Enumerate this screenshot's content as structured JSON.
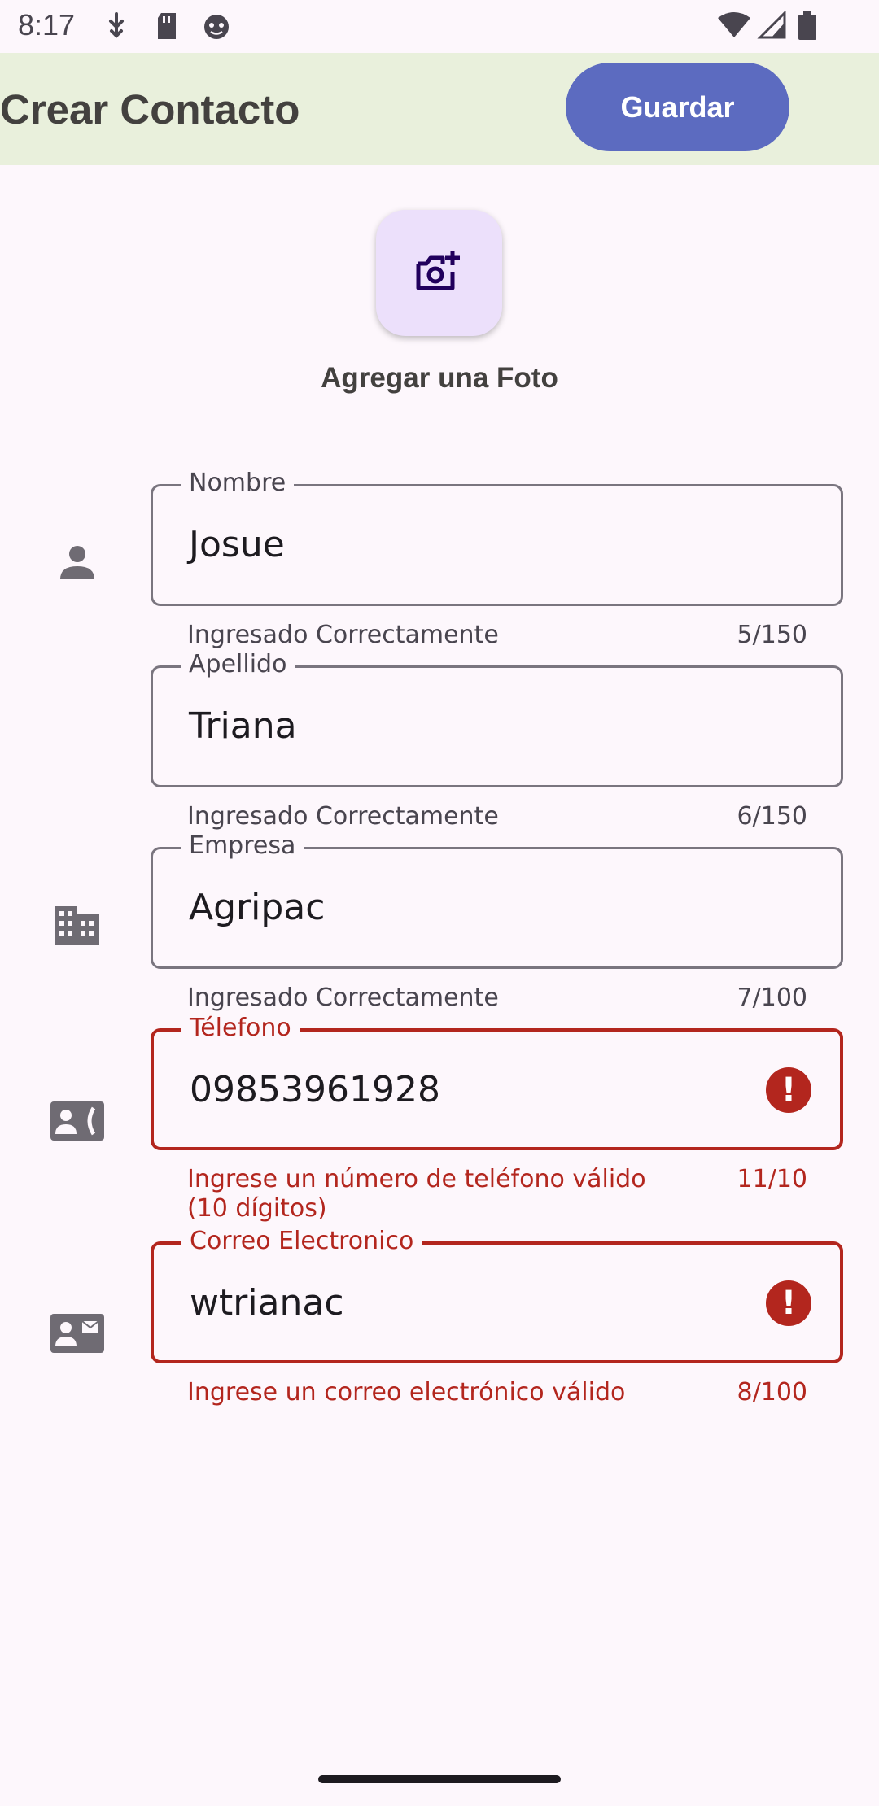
{
  "status_bar": {
    "time": "8:17",
    "left_icons": [
      "usb-debug-icon",
      "sd-card-icon",
      "android-face-icon"
    ],
    "right_icons": [
      "wifi-icon",
      "cell-signal-icon",
      "battery-icon"
    ]
  },
  "app_bar": {
    "title": "Crear Contacto",
    "save_label": "Guardar",
    "background": "#e9f0dc",
    "button_color": "#5c6bc0"
  },
  "photo": {
    "icon": "add-a-photo-icon",
    "label": "Agregar una Foto"
  },
  "fields": [
    {
      "label": "Nombre",
      "value": "Josue",
      "support": "Ingresado Correctamente",
      "counter": "5/150",
      "error": false
    },
    {
      "label": "Apellido",
      "value": "Triana",
      "support": "Ingresado Correctamente",
      "counter": "6/150",
      "error": false
    },
    {
      "label": "Empresa",
      "value": "Agripac",
      "support": "Ingresado Correctamente",
      "counter": "7/100",
      "error": false
    },
    {
      "label": "Télefono",
      "value": "09853961928",
      "support_line1": "Ingrese un número de teléfono válido",
      "support_line2": "(10 dígitos)",
      "counter": "11/10",
      "error": true
    },
    {
      "label": "Correo Electronico",
      "value": "wtrianac",
      "support": "Ingrese un correo electrónico válido",
      "counter": "8/100",
      "error": true
    }
  ],
  "colors": {
    "error": "#b3261e",
    "outline": "#7a757f",
    "background": "#fdf7fc"
  }
}
